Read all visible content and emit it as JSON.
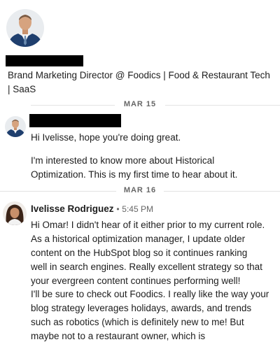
{
  "profile": {
    "headline": "Brand Marketing Director @ Foodics | Food & Restaurant Tech | SaaS"
  },
  "dates": {
    "first": "MAR 15",
    "second": "MAR 16"
  },
  "message1": {
    "para1": "Hi Ivelisse, hope you're doing great.",
    "para2": "I'm interested to know more about Historical Optimization. This is my first time to hear about it."
  },
  "message2": {
    "sender": "Ivelisse Rodriguez",
    "separator": "•",
    "time": "5:45 PM",
    "para1": "Hi Omar! I didn't hear of it either prior to my current role. As a historical optimization manager, I update older content on the HubSpot blog so it continues ranking well in search engines. Really excellent strategy so that your evergreen content continues performing well!",
    "para2": "I'll be sure to check out Foodics. I really like the way your blog strategy leverages holidays, awards, and trends such as robotics (which is definitely new to me! But maybe not to a restaurant owner, which is"
  },
  "colors": {
    "redaction": "#000000",
    "divider": "#e3e3e3"
  }
}
